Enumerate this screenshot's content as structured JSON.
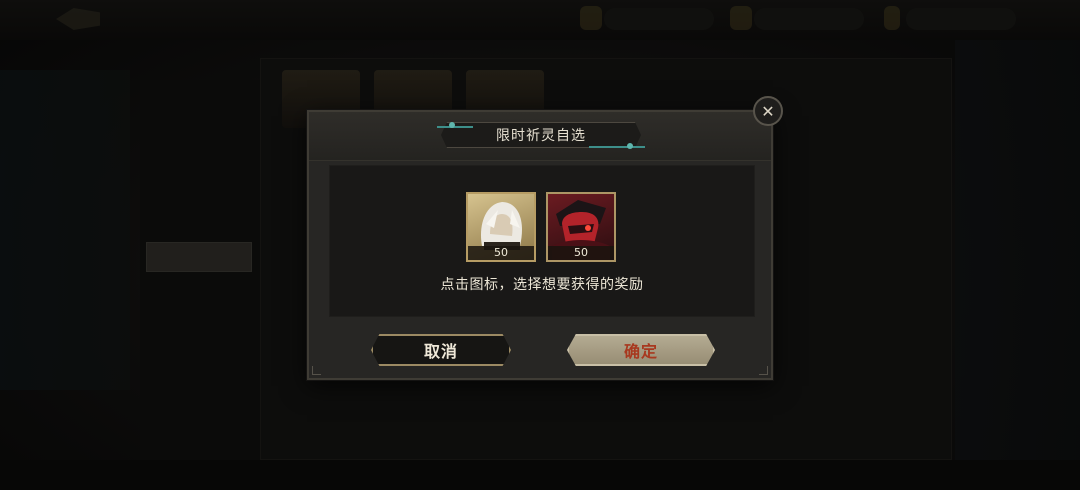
{
  "dialog": {
    "title": "限时祈灵自选",
    "hint": "点击图标，选择想要获得的奖励",
    "rewards": [
      {
        "icon": "white-haired-character-portrait-icon",
        "count": "50",
        "frame": "gold"
      },
      {
        "icon": "red-masked-character-portrait-icon",
        "count": "50",
        "frame": "red"
      }
    ],
    "cancel_label": "取消",
    "confirm_label": "确定",
    "close_icon": "close-icon"
  },
  "colors": {
    "dialog_bg": "#272624",
    "content_bg": "#191817",
    "confirm_text": "#a8381f",
    "accent_teal": "#3d8f8a",
    "gold_border": "#b69c64"
  }
}
